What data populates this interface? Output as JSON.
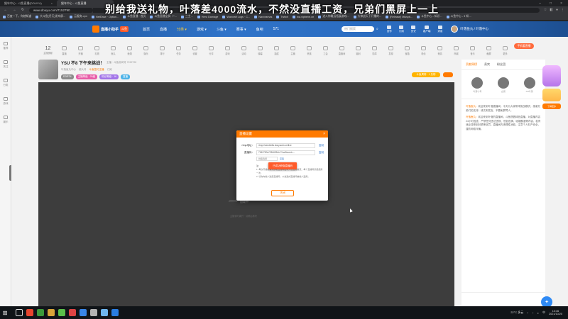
{
  "overlay": {
    "text": "别给我送礼物，叶落差4000流水，不然没直播工资，兄弟们黑屏上一上"
  },
  "browser": {
    "tabs": [
      {
        "label": "猴年中心 - 斗鱼直播(DOUYU)",
        "active": false
      },
      {
        "label": "猴年中心 - 斗鱼直播",
        "active": true
      }
    ],
    "url": "www.douyu.com/7152790",
    "bookmarks": [
      "百度一下，你就知道",
      "大斗鱼(丹天)发布屏...",
      "云服务-vpn",
      "NetEase · Option...",
      "斗鱼直播 · 首页",
      "斗鱼直播全屏（^...",
      "三主...",
      "Hero Damage",
      "Warcraft Logs · C...",
      "Naxxramas",
      "Twitch",
      "wa.vipbeve.cn",
      "进入你最远拓展游戏...",
      "大神战天下开播的...",
      "[Release] Missyb...",
      "斗鱼中心 - 知识...",
      "斗鱼中心 - 3 知 ..."
    ]
  },
  "site": {
    "logo_text": "直播小助手",
    "logo_tag": "斗鱼",
    "nav": [
      "首页",
      "直播",
      "分类 ▾",
      "游戏 ▾",
      "斗鱼 ▾",
      "赛事 ▾",
      "鱼吧",
      "571"
    ],
    "nav_hot_index": 2,
    "search_placeholder": "热门搜索",
    "header_icons": [
      "创作",
      "订阅",
      "历史",
      "客户端",
      "消息"
    ],
    "user_label": "叶落鱼丸 / 叶落中心"
  },
  "sidebar": {
    "items": [
      "推荐",
      "关注",
      "分类",
      "游戏",
      "娱乐"
    ]
  },
  "toolstrip": {
    "count": "12",
    "count_label": "主播贡献",
    "items": [
      "直播",
      "开播",
      "礼物",
      "鱼丸",
      "鱼翅",
      "娱乐",
      "排行",
      "任务",
      "设置",
      "分享",
      "游戏",
      "活动",
      "弹幕",
      "抽奖",
      "主播",
      "贵族",
      "工会",
      "直播间",
      "福利",
      "勋章",
      "发现",
      "宝箱",
      "粉丝",
      "竞猜",
      "商城",
      "音乐",
      "截屏",
      "更多"
    ],
    "right_btn": "手机看直播"
  },
  "streamer": {
    "title": "YSU 不8 下午来挑战！",
    "sub": "主播 · 斗鱼房间号 7152790",
    "meta": [
      "叶落鱼丸中心",
      "超大号",
      "斗鱼签约主播",
      "订阅"
    ],
    "meta_highlight_index": 2,
    "tags": [
      "DDRT4",
      "主播等级 · 20级",
      "粉丝等级 · 16",
      "直播"
    ],
    "rank": "斗鱼周榜 · 1 总榜"
  },
  "video": {
    "loading": "加载中",
    "sub": "主播暂时离开 · 请稍后再来"
  },
  "right_panel": {
    "tabs": [
      "贡献周榜",
      "贵宾",
      "粉丝团"
    ],
    "active_tab": 0,
    "ranks": [
      "叶落小号",
      "白菜",
      "AA叶落"
    ],
    "messages": [
      {
        "who": "叶落鱼丸：",
        "text": "欢迎来到叶落直播间，今天为大家带来挑战模式，感谢兄弟们的支持！请文明发言，不要刷屏骂人。"
      },
      {
        "who": "叶落鱼丸：",
        "text": "欢迎来到叶落的直播间，斗鱼提倡绿色直播，对直播内容24小时巡查，严禁任何违法违规、低俗色情、吸烟酗酒等内容，若有违反将受到封禁等处罚。直播间内请理性消费，注意个人财产安全，谨防网络诈骗。"
      }
    ]
  },
  "float_ad": {
    "btn": "了解更多"
  },
  "modal": {
    "title": "直播设置",
    "close": "×",
    "rtmp_label": "rtmp地址：",
    "rtmp_value": "rtmp://sendtc3a.douyucdn.cn/live",
    "rtmp_action": "复制",
    "key_label": "直播码：",
    "key_value": "7152790rYEDrfCBLkY?wsSecret=...",
    "key_action": "复制",
    "select_label": "线路选择",
    "link_label": "获取",
    "toast": "已成功获取直播码",
    "tips_title": "注：",
    "tips": [
      "1. 每次开播前需先获取直播码后再开启直播推流，每个直播码仅能使用一次。",
      "2. 切勿向他人透露直播码，以免造成直播间被他人盗用。"
    ],
    "confirm": "关闭"
  },
  "taskbar": {
    "weather": "22°C 多云",
    "time": "13:46",
    "date": "2021/10/20",
    "app_colors": [
      "#ffffff",
      "#e6452e",
      "#3c9a3b",
      "#d9a43a",
      "#5abf4a",
      "#d44",
      "#3a86e8",
      "#b3b3b3",
      "#6fb7f0",
      "#2a7de1"
    ]
  }
}
